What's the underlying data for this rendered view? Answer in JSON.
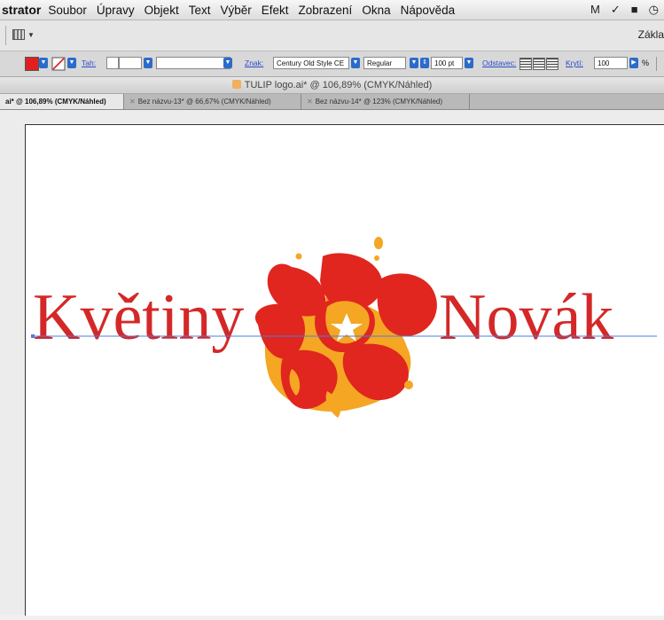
{
  "menu": {
    "app_name": "strator",
    "items": [
      "Soubor",
      "Úpravy",
      "Objekt",
      "Text",
      "Výběr",
      "Efekt",
      "Zobrazení",
      "Okna",
      "Nápověda"
    ],
    "tray": [
      "M",
      "✓",
      "■",
      "◷"
    ]
  },
  "appbar": {
    "workspace_label": "Zákla"
  },
  "control": {
    "fill_color": "#e02020",
    "stroke_label": "Tah:",
    "char_label": "Znak:",
    "font_family": "Century Old Style CE",
    "font_style": "Regular",
    "font_size": "100 pt",
    "paragraph_label": "Odstavec:",
    "opacity_label": "Krytí:",
    "opacity_value": "100",
    "opacity_unit": "%"
  },
  "window": {
    "title": "TULIP logo.ai* @ 106,89% (CMYK/Náhled)"
  },
  "tabs": [
    {
      "label": "ai* @ 106,89% (CMYK/Náhled)",
      "active": true
    },
    {
      "label": "Bez názvu-13* @ 66,67% (CMYK/Náhled)",
      "active": false
    },
    {
      "label": "Bez názvu-14* @ 123% (CMYK/Náhled)",
      "active": false
    }
  ],
  "artwork": {
    "word_left": "Květiny",
    "word_right": "Novák",
    "text_color": "#d42828",
    "flower_red": "#e0261f",
    "flower_orange": "#f5a623",
    "baseline_color": "#4a7de0"
  }
}
